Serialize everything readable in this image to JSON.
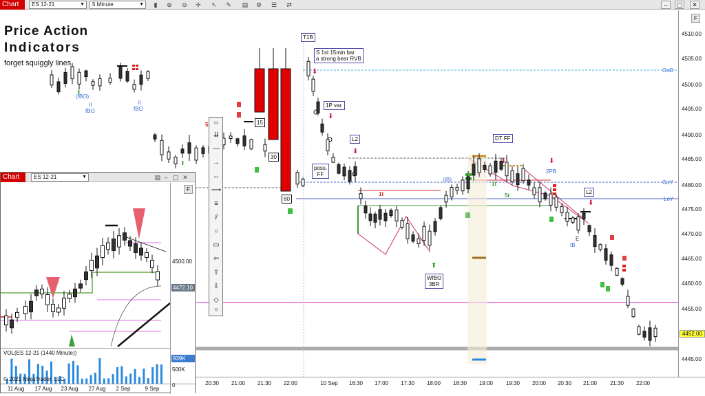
{
  "toolbar": {
    "tab_label": "Chart",
    "instrument": "ES 12-21",
    "interval": "5 Minute",
    "icons": [
      "bar-type-icon",
      "zoom-in-icon",
      "zoom-out-icon",
      "crosshair-icon",
      "pointer-icon",
      "draw-tool-icon",
      "template-icon",
      "properties-icon",
      "strategy-icon",
      "sim-icon",
      "settings-icon"
    ]
  },
  "window": {
    "minimize": "–",
    "maximize": "▢",
    "close": "✕"
  },
  "watermark": {
    "line1": "Price Action",
    "line2": "Indicators",
    "line3": "forget squiggly lines"
  },
  "price_axis": {
    "ticks": [
      "4510.00",
      "4505.00",
      "4500.00",
      "4495.00",
      "4490.00",
      "4485.00",
      "4480.00",
      "4475.00",
      "4470.00",
      "4465.00",
      "4460.00",
      "4455.00",
      "4450.00",
      "4445.00"
    ],
    "current_price": "4452.00",
    "f_button": "F"
  },
  "time_axis": {
    "ticks": [
      "20:30",
      "21:00",
      "21:30",
      "22:00",
      "10 Sep",
      "16:30",
      "17:00",
      "17:30",
      "18:00",
      "18:30",
      "19:00",
      "19:30",
      "20:00",
      "20:30",
      "21:00",
      "21:30",
      "22:00"
    ]
  },
  "line_labels": {
    "ood": "OoD",
    "coy": "CoY",
    "loy": "LoY"
  },
  "annotations": {
    "t1b": "T1B",
    "s1st_line1": "S 1st 15min bar",
    "s1st_line2": "a strong bear RVB",
    "one_p": "1P var.",
    "l2a": "L2",
    "poss1": "poss.",
    "poss2": "FF",
    "dtff": "DT FF",
    "twopb": "2PB",
    "l2b": "L2",
    "wfbo1": "WfBO",
    "wfbo2": "3BR",
    "ib_small": "(IB)",
    "ib": "IB",
    "onet": "1t",
    "onet2": "1t",
    "fivet": "5t",
    "fbo_paren": "(fBO)",
    "ii1": "II",
    "fbo1": "fBO",
    "ii2": "II",
    "fbo2": "fBO",
    "bar15": "15",
    "bar30": "30",
    "bar60": "60",
    "five_r": "5",
    "e": "E"
  },
  "inset": {
    "tab_label": "Chart",
    "instrument": "ES 12-21",
    "price_tick": "4500.00",
    "current_value": "4472.10",
    "f_button": "F",
    "vol_label": "VOL(ES 12-21 (1440 Minute))",
    "vol_value": "939K",
    "vol_ticks": [
      "500K",
      "0"
    ],
    "copyright": "© 2021 NinjaTrader, LLC",
    "time_ticks": [
      "11 Aug",
      "17 Aug",
      "23 Aug",
      "27 Aug",
      "2 Sep",
      "9 Sep"
    ]
  }
}
